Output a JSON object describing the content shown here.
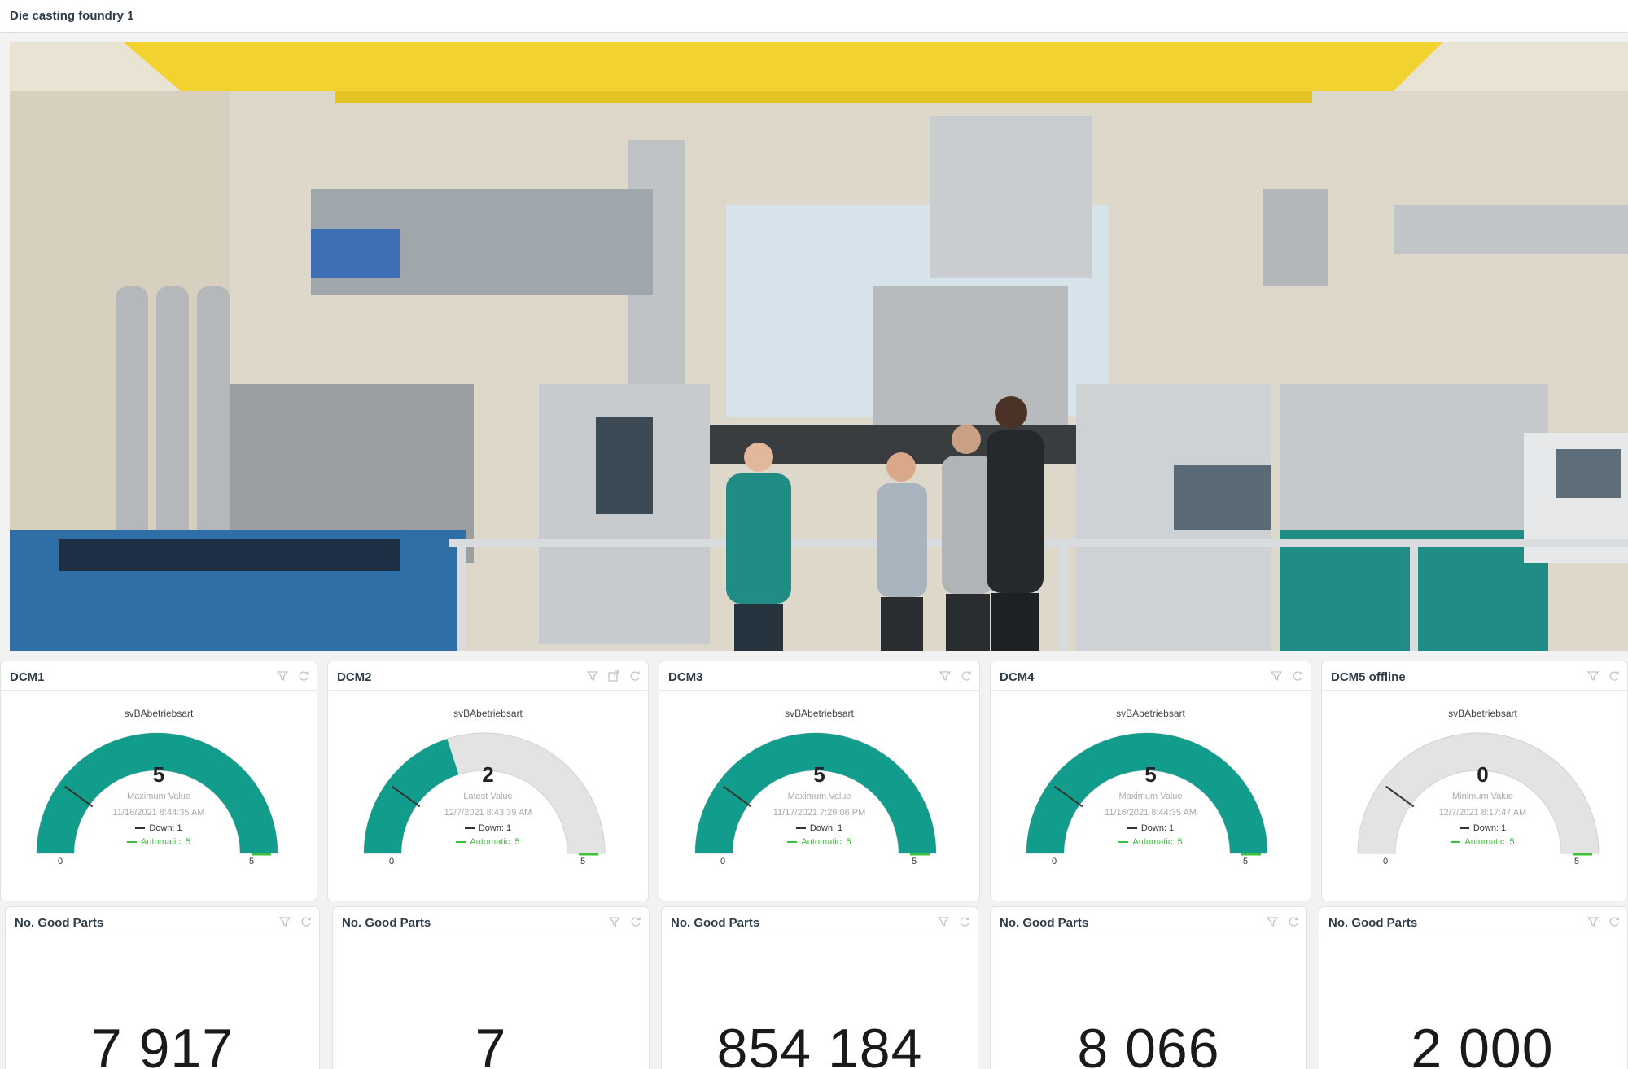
{
  "page": {
    "title": "Die casting foundry 1"
  },
  "hero": {
    "name": "factory-photo",
    "colors": {
      "crane": "#f2d22e",
      "machine": "#b9bcbf",
      "teal": "#1f8c86",
      "blue": "#2f6fa7"
    }
  },
  "colors": {
    "accent": "#129c8c",
    "track": "#e3e3e3",
    "automatic": "#3cc13b"
  },
  "gauges": [
    {
      "title": "DCM1",
      "label": "svBAbetriebsart",
      "value": "5",
      "subtitle": "Maximum Value",
      "timestamp": "11/16/2021 8:44:35 AM",
      "min_label": "0",
      "max_label": "5",
      "min": 0,
      "max": 5,
      "fill": 5,
      "marker": 1,
      "legend_down": "Down: 1",
      "legend_auto": "Automatic: 5",
      "has_export": false
    },
    {
      "title": "DCM2",
      "label": "svBAbetriebsart",
      "value": "2",
      "subtitle": "Latest Value",
      "timestamp": "12/7/2021 8:43:39 AM",
      "min_label": "0",
      "max_label": "5",
      "min": 0,
      "max": 5,
      "fill": 2,
      "marker": 1,
      "legend_down": "Down: 1",
      "legend_auto": "Automatic: 5",
      "has_export": true
    },
    {
      "title": "DCM3",
      "label": "svBAbetriebsart",
      "value": "5",
      "subtitle": "Maximum Value",
      "timestamp": "11/17/2021 7:29:06 PM",
      "min_label": "0",
      "max_label": "5",
      "min": 0,
      "max": 5,
      "fill": 5,
      "marker": 1,
      "legend_down": "Down: 1",
      "legend_auto": "Automatic: 5",
      "has_export": false
    },
    {
      "title": "DCM4",
      "label": "svBAbetriebsart",
      "value": "5",
      "subtitle": "Maximum Value",
      "timestamp": "11/16/2021 8:44:35 AM",
      "min_label": "0",
      "max_label": "5",
      "min": 0,
      "max": 5,
      "fill": 5,
      "marker": 1,
      "legend_down": "Down: 1",
      "legend_auto": "Automatic: 5",
      "has_export": false
    },
    {
      "title": "DCM5 offline",
      "label": "svBAbetriebsart",
      "value": "0",
      "subtitle": "Minimum Value",
      "timestamp": "12/7/2021 8:17:47 AM",
      "min_label": "0",
      "max_label": "5",
      "min": 0,
      "max": 5,
      "fill": 0,
      "marker": 1,
      "legend_down": "Down: 1",
      "legend_auto": "Automatic: 5",
      "has_export": false
    }
  ],
  "kpis": [
    {
      "title": "No. Good Parts",
      "value": "7 917"
    },
    {
      "title": "No. Good Parts",
      "value": "7"
    },
    {
      "title": "No. Good Parts",
      "value": "854 184"
    },
    {
      "title": "No. Good Parts",
      "value": "8 066"
    },
    {
      "title": "No. Good Parts",
      "value": "2 000"
    }
  ]
}
